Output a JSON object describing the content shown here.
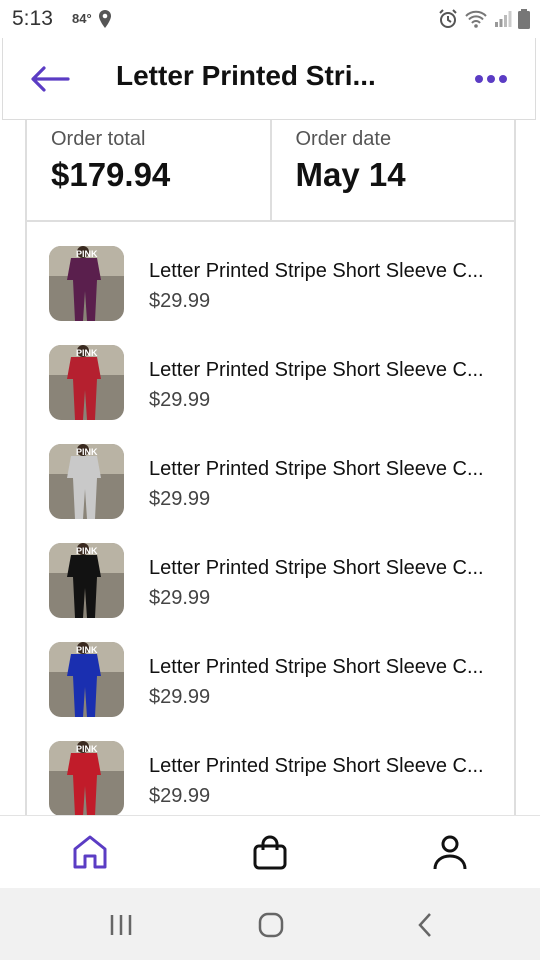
{
  "status_bar": {
    "time": "5:13",
    "temperature": "84°"
  },
  "header": {
    "title": "Letter Printed Stri...",
    "back_icon": "arrow-left-icon",
    "more_icon": "more-dots-icon"
  },
  "summary": {
    "total_label": "Order total",
    "total_value": "$179.94",
    "date_label": "Order date",
    "date_value": "May 14"
  },
  "items": [
    {
      "title": "Letter Printed Stripe Short Sleeve C...",
      "price": "$29.99",
      "color": "#5a1f4d"
    },
    {
      "title": "Letter Printed Stripe Short Sleeve C...",
      "price": "$29.99",
      "color": "#b5202f"
    },
    {
      "title": "Letter Printed Stripe Short Sleeve C...",
      "price": "$29.99",
      "color": "#c9c9c9"
    },
    {
      "title": "Letter Printed Stripe Short Sleeve C...",
      "price": "$29.99",
      "color": "#121212"
    },
    {
      "title": "Letter Printed Stripe Short Sleeve C...",
      "price": "$29.99",
      "color": "#1a2fb0"
    },
    {
      "title": "Letter Printed Stripe Short Sleeve C...",
      "price": "$29.99",
      "color": "#c11c2a"
    }
  ],
  "bottom_nav": {
    "items": [
      "home-icon",
      "shopping-bag-icon",
      "profile-icon"
    ],
    "active_color": "#5b3cc4"
  },
  "colors": {
    "accent": "#5b3cc4",
    "border": "#dedede"
  }
}
